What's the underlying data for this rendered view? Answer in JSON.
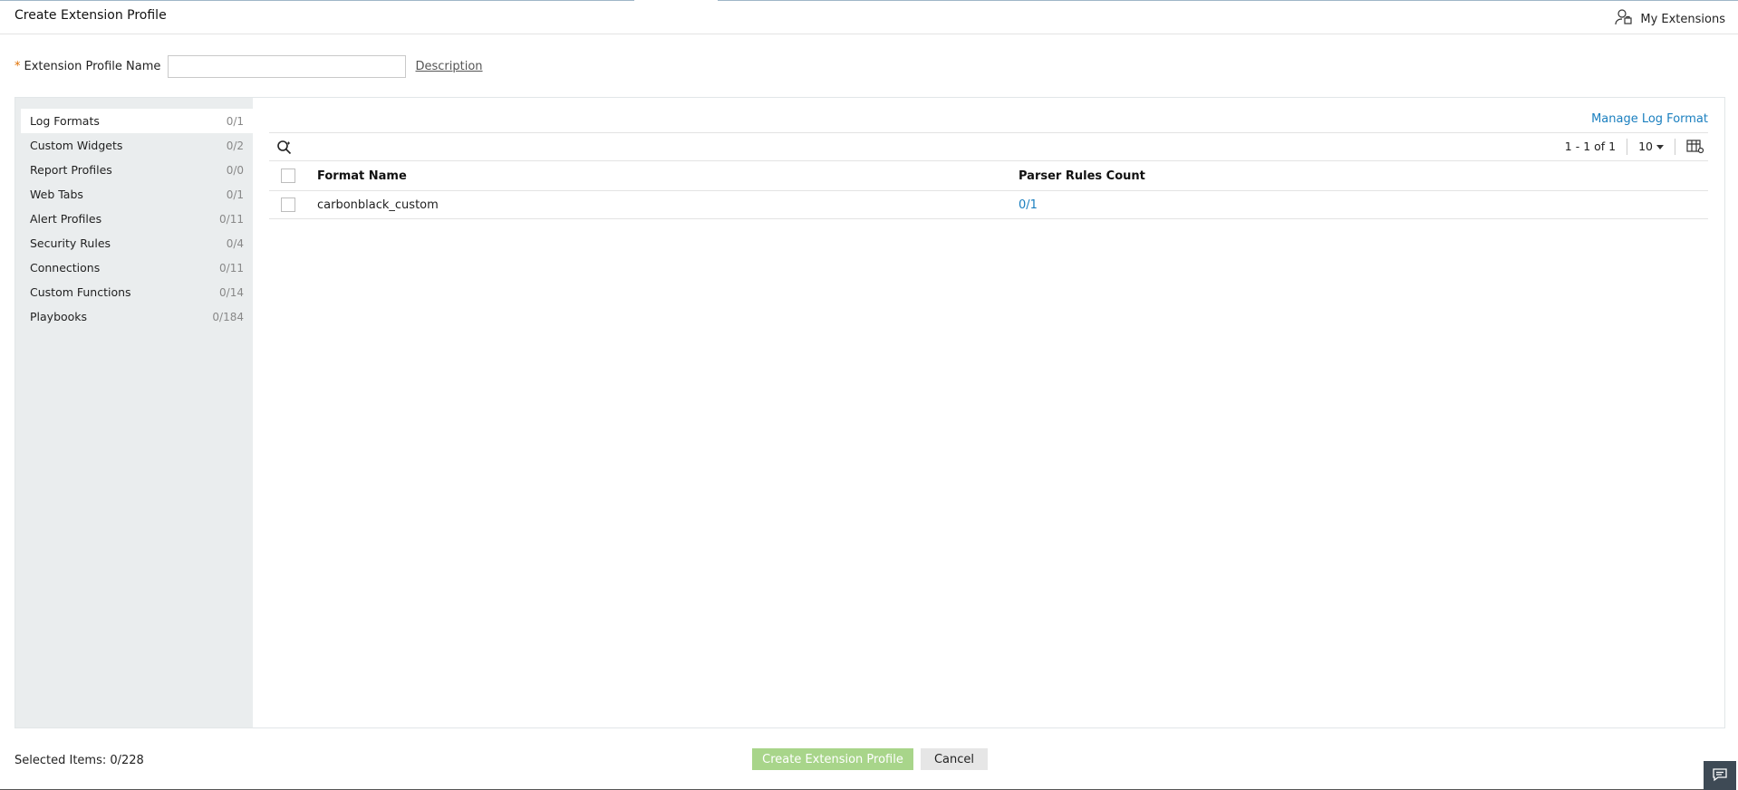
{
  "header": {
    "title": "Create Extension Profile",
    "my_extensions_label": "My Extensions"
  },
  "form": {
    "required_marker": "*",
    "name_label": "Extension Profile Name",
    "name_value": "",
    "name_placeholder": "",
    "description_link": "Description"
  },
  "sidebar": {
    "items": [
      {
        "label": "Log Formats",
        "count": "0/1"
      },
      {
        "label": "Custom Widgets",
        "count": "0/2"
      },
      {
        "label": "Report Profiles",
        "count": "0/0"
      },
      {
        "label": "Web Tabs",
        "count": "0/1"
      },
      {
        "label": "Alert Profiles",
        "count": "0/11"
      },
      {
        "label": "Security Rules",
        "count": "0/4"
      },
      {
        "label": "Connections",
        "count": "0/11"
      },
      {
        "label": "Custom Functions",
        "count": "0/14"
      },
      {
        "label": "Playbooks",
        "count": "0/184"
      }
    ]
  },
  "main": {
    "manage_link": "Manage Log Format",
    "pager_range": "1 - 1 of 1",
    "page_size": "10",
    "table": {
      "columns": [
        "Format Name",
        "Parser Rules Count"
      ],
      "rows": [
        {
          "format_name": "carbonblack_custom",
          "parser_rules_count": "0/1"
        }
      ]
    }
  },
  "footer": {
    "selected_items": "Selected Items: 0/228",
    "create_label": "Create Extension Profile",
    "cancel_label": "Cancel"
  },
  "colors": {
    "link": "#1a7fbf",
    "create_button": "#a8d58a",
    "sidebar_bg": "#eaedee",
    "chat_bg": "#3e4a55"
  }
}
